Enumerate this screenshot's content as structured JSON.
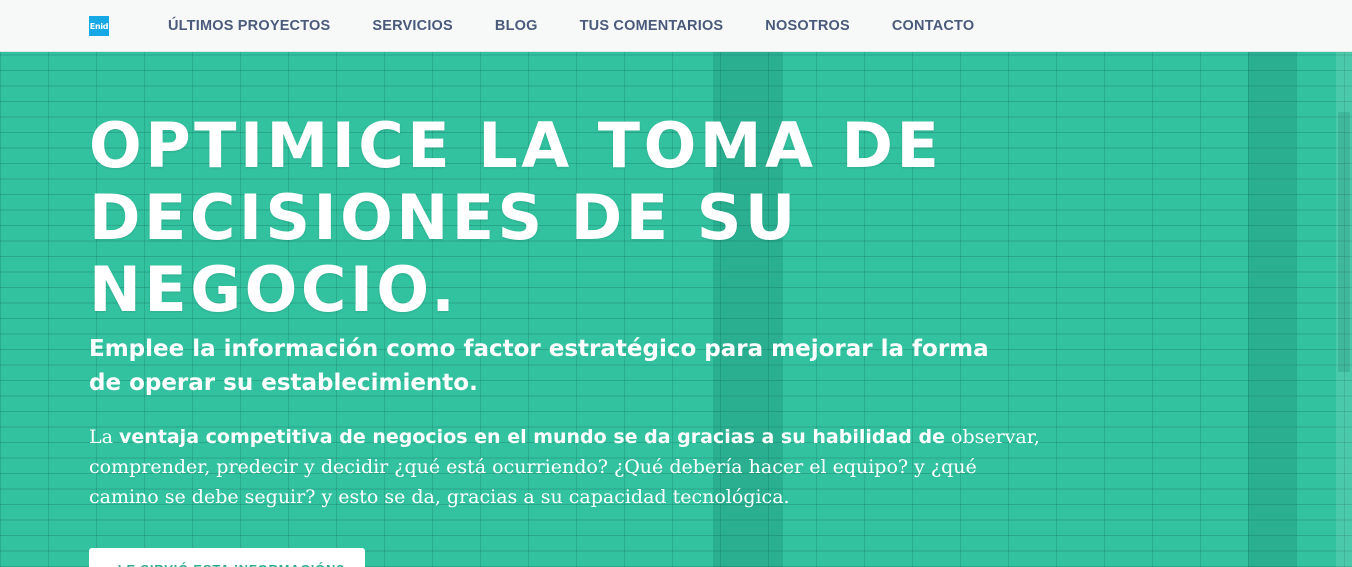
{
  "brand": {
    "logo_text": "Enid",
    "logo_color": "#17a9e6"
  },
  "nav": {
    "items": [
      {
        "label": "ÚLTIMOS PROYECTOS"
      },
      {
        "label": "SERVICIOS"
      },
      {
        "label": "BLOG"
      },
      {
        "label": "TUS COMENTARIOS"
      },
      {
        "label": "NOSOTROS"
      },
      {
        "label": "CONTACTO"
      }
    ]
  },
  "hero": {
    "title_line1": "OPTIMICE LA TOMA DE",
    "title_line2": "DECISIONES DE SU NEGOCIO.",
    "subtitle": "Emplee la información como factor estratégico para mejorar la forma de operar su establecimiento.",
    "body_prefix": "La ",
    "body_bold": "ventaja competitiva de negocios en el mundo se da gracias a su habilidad de",
    "body_rest": " observar, comprender, predecir y decidir ¿qué está ocurriendo? ¿Qué debería hacer el equipo? y ¿qué camino se debe seguir? y esto se da, gracias a su capacidad tecnológica.",
    "cta_label": "¿LE SIRVIÓ ESTA INFORMACIÓN?"
  },
  "colors": {
    "overlay": "#2fbf9c",
    "nav_text": "#4a5a7a",
    "cta_text": "#2fae8f",
    "header_bg": "#f7f9f9"
  }
}
